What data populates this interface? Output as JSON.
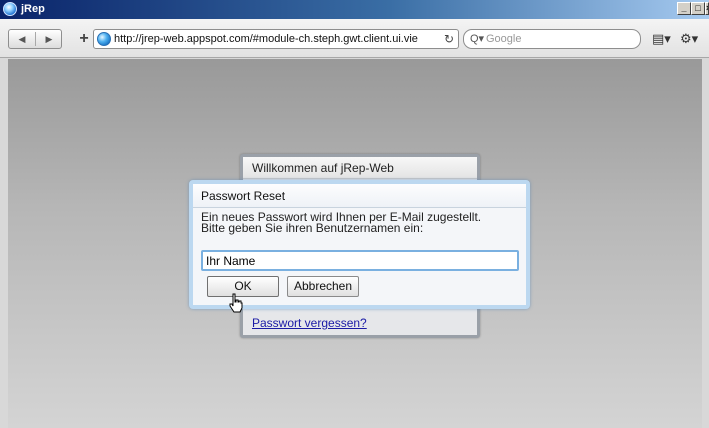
{
  "window": {
    "title": "jRep"
  },
  "toolbar": {
    "back_icon": "back-arrow",
    "forward_icon": "forward-arrow",
    "back_glyph": "◀",
    "forward_glyph": "▶",
    "add_glyph": "+",
    "url": "http://jrep-web.appspot.com/#module-ch.steph.gwt.client.ui.vie",
    "reload_glyph": "↻",
    "search_glyph": "Q▾",
    "search_placeholder": "Google",
    "page_menu_glyph": "▤▾",
    "tools_menu_glyph": "⚙▾"
  },
  "login_panel": {
    "title": "Willkommen auf jRep-Web",
    "forgot_link": "Passwort vergessen?"
  },
  "dialog": {
    "title": "Passwort Reset",
    "message_line1": "Ein neues Passwort wird Ihnen per E-Mail zugestellt.",
    "message_line2": "Bitte geben Sie ihren Benutzernamen ein:",
    "name_value": "Ihr Name",
    "ok_label": "OK",
    "cancel_label": "Abbrechen"
  },
  "colors": {
    "titlebar": "#0a246a",
    "dialog_border": "#bcd8f0",
    "link": "#1a1aa6"
  }
}
